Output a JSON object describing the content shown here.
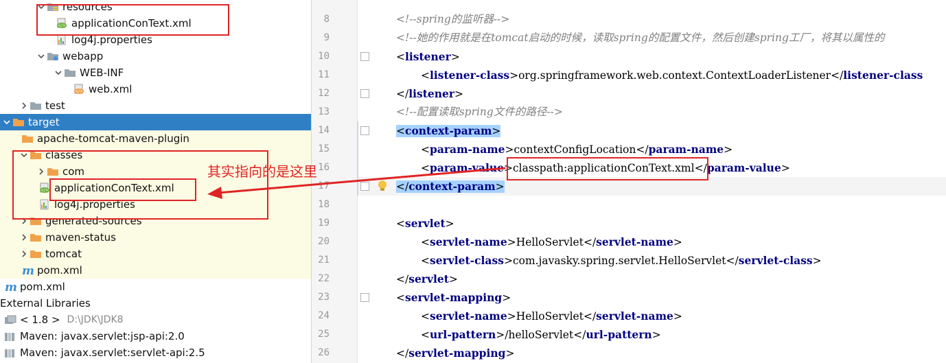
{
  "tree": {
    "items": [
      {
        "label": "resources",
        "arrow": "down",
        "icon": "resources-folder-icon",
        "indent": 52
      },
      {
        "label": "applicationConText.xml",
        "arrow": "",
        "icon": "spring-xml-icon",
        "indent": 77
      },
      {
        "label": "log4j.properties",
        "arrow": "",
        "icon": "properties-file-icon",
        "indent": 77
      },
      {
        "label": "webapp",
        "arrow": "down",
        "icon": "web-folder-icon",
        "indent": 52
      },
      {
        "label": "WEB-INF",
        "arrow": "down",
        "icon": "folder-icon",
        "indent": 77
      },
      {
        "label": "web.xml",
        "arrow": "",
        "icon": "xml-file-icon",
        "indent": 102
      },
      {
        "label": "test",
        "arrow": "right",
        "icon": "folder-icon",
        "indent": 27
      },
      {
        "label": "target",
        "arrow": "down",
        "icon": "orange-folder-icon",
        "indent": 2
      },
      {
        "label": "apache-tomcat-maven-plugin",
        "arrow": "",
        "icon": "orange-folder-icon",
        "indent": 27
      },
      {
        "label": "classes",
        "arrow": "down",
        "icon": "orange-folder-icon",
        "indent": 27
      },
      {
        "label": "com",
        "arrow": "right",
        "icon": "orange-folder-icon",
        "indent": 52
      },
      {
        "label": "applicationConText.xml",
        "arrow": "",
        "icon": "spring-xml-icon",
        "indent": 52
      },
      {
        "label": "log4j.properties",
        "arrow": "",
        "icon": "properties-file-icon",
        "indent": 52
      },
      {
        "label": "generated-sources",
        "arrow": "right",
        "icon": "orange-folder-icon",
        "indent": 27
      },
      {
        "label": "maven-status",
        "arrow": "right",
        "icon": "orange-folder-icon",
        "indent": 27
      },
      {
        "label": "tomcat",
        "arrow": "right",
        "icon": "orange-folder-icon",
        "indent": 27
      },
      {
        "label": "pom.xml",
        "arrow": "",
        "icon": "maven-icon",
        "indent": 27
      },
      {
        "label": "pom.xml",
        "arrow": "",
        "icon": "maven-icon",
        "indent": 2
      },
      {
        "label": "External Libraries",
        "arrow": "",
        "icon": "",
        "indent": 0
      },
      {
        "label": "< 1.8 >",
        "path": "D:\\JDK\\JDK8",
        "arrow": "",
        "icon": "jdk-library-icon",
        "indent": 2
      },
      {
        "label": "Maven: javax.servlet:jsp-api:2.0",
        "arrow": "",
        "icon": "library-icon",
        "indent": 2
      },
      {
        "label": "Maven: javax.servlet:servlet-api:2.5",
        "arrow": "",
        "icon": "library-icon",
        "indent": 2
      }
    ]
  },
  "annotation": {
    "text": "其实指向的是这里",
    "color": "#e02424"
  },
  "editor": {
    "lines": [
      {
        "n": "8",
        "parts": [
          {
            "c": "cmt",
            "t": "<!--spring的监听器-->"
          }
        ],
        "indent": 0
      },
      {
        "n": "9",
        "parts": [
          {
            "c": "cmt",
            "t": "<!--她的作用就是在tomcat启动的时候，读取spring的配置文件，然后创建spring工厂，将其以属性的"
          }
        ],
        "indent": 0
      },
      {
        "n": "10",
        "parts": [
          {
            "c": "br",
            "t": "<"
          },
          {
            "c": "tag",
            "t": "listener"
          },
          {
            "c": "br",
            "t": ">"
          }
        ],
        "indent": 0
      },
      {
        "n": "11",
        "parts": [
          {
            "c": "br",
            "t": "<"
          },
          {
            "c": "tag",
            "t": "listener-class"
          },
          {
            "c": "br",
            "t": ">"
          },
          {
            "c": "txt",
            "t": "org.springframework.web.context.ContextLoaderListener"
          },
          {
            "c": "br",
            "t": "</"
          },
          {
            "c": "tag",
            "t": "listener-class"
          }
        ],
        "indent": 1
      },
      {
        "n": "12",
        "parts": [
          {
            "c": "br",
            "t": "</"
          },
          {
            "c": "tag",
            "t": "listener"
          },
          {
            "c": "br",
            "t": ">"
          }
        ],
        "indent": 0
      },
      {
        "n": "13",
        "parts": [
          {
            "c": "cmt",
            "t": "<!--配置读取spring文件的路径-->"
          }
        ],
        "indent": 0
      },
      {
        "n": "14",
        "parts": [
          {
            "c": "br",
            "t": "<"
          },
          {
            "c": "tag",
            "t": "context-param"
          },
          {
            "c": "br",
            "t": ">"
          }
        ],
        "indent": 0,
        "sel": true
      },
      {
        "n": "15",
        "parts": [
          {
            "c": "br",
            "t": "<"
          },
          {
            "c": "tag",
            "t": "param-name"
          },
          {
            "c": "br",
            "t": ">"
          },
          {
            "c": "txt",
            "t": "contextConfigLocation"
          },
          {
            "c": "br",
            "t": "</"
          },
          {
            "c": "tag",
            "t": "param-name"
          },
          {
            "c": "br",
            "t": ">"
          }
        ],
        "indent": 1
      },
      {
        "n": "16",
        "parts": [
          {
            "c": "br",
            "t": "<"
          },
          {
            "c": "tag",
            "t": "param-value"
          },
          {
            "c": "br",
            "t": ">"
          },
          {
            "c": "txt",
            "t": "classpath:applicationConText.xml"
          },
          {
            "c": "br",
            "t": "</"
          },
          {
            "c": "tag",
            "t": "param-value"
          },
          {
            "c": "br",
            "t": ">"
          }
        ],
        "indent": 1
      },
      {
        "n": "17",
        "parts": [
          {
            "c": "br",
            "t": "</"
          },
          {
            "c": "tag",
            "t": "context-param"
          },
          {
            "c": "br",
            "t": ">"
          }
        ],
        "indent": 0,
        "sel": true,
        "current": true
      },
      {
        "n": "18",
        "parts": [],
        "indent": 0
      },
      {
        "n": "19",
        "parts": [
          {
            "c": "br",
            "t": "<"
          },
          {
            "c": "tag",
            "t": "servlet"
          },
          {
            "c": "br",
            "t": ">"
          }
        ],
        "indent": 0
      },
      {
        "n": "20",
        "parts": [
          {
            "c": "br",
            "t": "<"
          },
          {
            "c": "tag",
            "t": "servlet-name"
          },
          {
            "c": "br",
            "t": ">"
          },
          {
            "c": "txt",
            "t": "HelloServlet"
          },
          {
            "c": "br",
            "t": "</"
          },
          {
            "c": "tag",
            "t": "servlet-name"
          },
          {
            "c": "br",
            "t": ">"
          }
        ],
        "indent": 1
      },
      {
        "n": "21",
        "parts": [
          {
            "c": "br",
            "t": "<"
          },
          {
            "c": "tag",
            "t": "servlet-class"
          },
          {
            "c": "br",
            "t": ">"
          },
          {
            "c": "txt",
            "t": "com.javasky.spring.servlet.HelloServlet"
          },
          {
            "c": "br",
            "t": "</"
          },
          {
            "c": "tag",
            "t": "servlet-class"
          },
          {
            "c": "br",
            "t": ">"
          }
        ],
        "indent": 1
      },
      {
        "n": "22",
        "parts": [
          {
            "c": "br",
            "t": "</"
          },
          {
            "c": "tag",
            "t": "servlet"
          },
          {
            "c": "br",
            "t": ">"
          }
        ],
        "indent": 0
      },
      {
        "n": "23",
        "parts": [
          {
            "c": "br",
            "t": "<"
          },
          {
            "c": "tag",
            "t": "servlet-mapping"
          },
          {
            "c": "br",
            "t": ">"
          }
        ],
        "indent": 0
      },
      {
        "n": "24",
        "parts": [
          {
            "c": "br",
            "t": "<"
          },
          {
            "c": "tag",
            "t": "servlet-name"
          },
          {
            "c": "br",
            "t": ">"
          },
          {
            "c": "txt",
            "t": "HelloServlet"
          },
          {
            "c": "br",
            "t": "</"
          },
          {
            "c": "tag",
            "t": "servlet-name"
          },
          {
            "c": "br",
            "t": ">"
          }
        ],
        "indent": 1
      },
      {
        "n": "25",
        "parts": [
          {
            "c": "br",
            "t": "<"
          },
          {
            "c": "tag",
            "t": "url-pattern"
          },
          {
            "c": "br",
            "t": ">"
          },
          {
            "c": "txt",
            "t": "/helloServlet"
          },
          {
            "c": "br",
            "t": "</"
          },
          {
            "c": "tag",
            "t": "url-pattern"
          },
          {
            "c": "br",
            "t": ">"
          }
        ],
        "indent": 1
      },
      {
        "n": "26",
        "parts": [
          {
            "c": "br",
            "t": "</"
          },
          {
            "c": "tag",
            "t": "servlet-mapping"
          },
          {
            "c": "br",
            "t": ">"
          }
        ],
        "indent": 0
      }
    ]
  }
}
